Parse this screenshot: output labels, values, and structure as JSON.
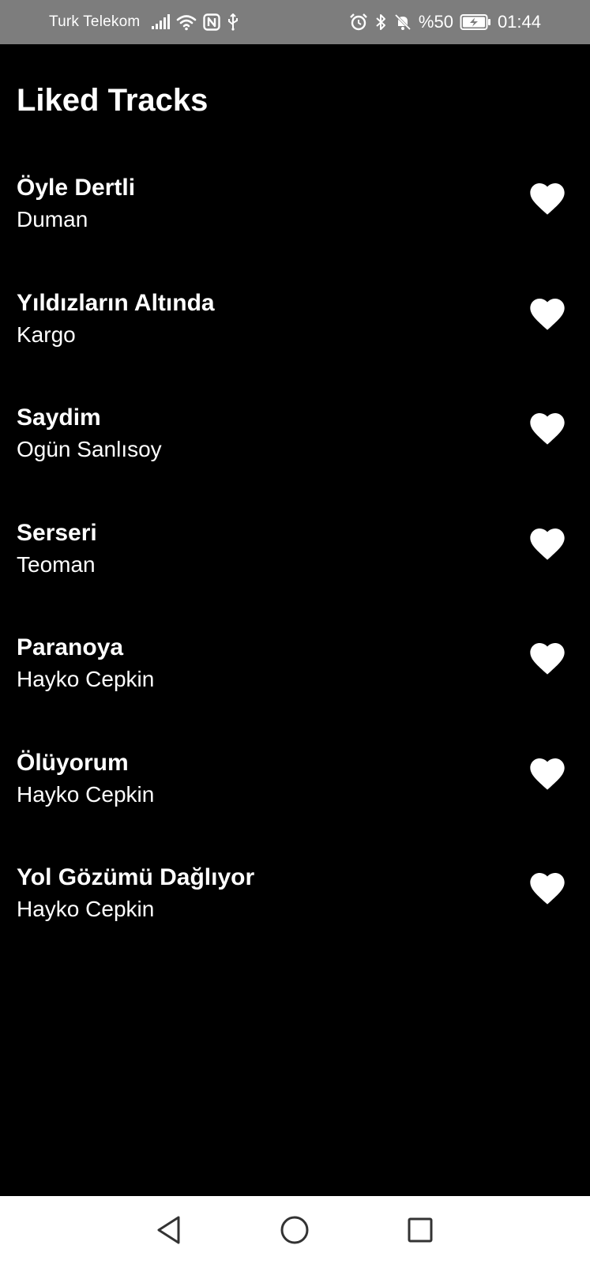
{
  "status_bar": {
    "carrier": "Turk Telekom",
    "battery_percent": "%50",
    "time": "01:44",
    "icons_left": [
      "signal-icon",
      "wifi-icon",
      "nfc-icon",
      "usb-icon"
    ],
    "icons_right": [
      "alarm-icon",
      "bluetooth-icon",
      "mute-icon",
      "battery-icon"
    ]
  },
  "page": {
    "title": "Liked Tracks"
  },
  "tracks": [
    {
      "title": "Öyle Dertli",
      "artist": "Duman",
      "liked": true
    },
    {
      "title": "Yıldızların Altında",
      "artist": "Kargo",
      "liked": true
    },
    {
      "title": "Saydim",
      "artist": "Ogün Sanlısoy",
      "liked": true
    },
    {
      "title": "Serseri",
      "artist": "Teoman",
      "liked": true
    },
    {
      "title": "Paranoya",
      "artist": "Hayko Cepkin",
      "liked": true
    },
    {
      "title": "Ölüyorum",
      "artist": "Hayko Cepkin",
      "liked": true
    },
    {
      "title": "Yol Gözümü Dağlıyor",
      "artist": "Hayko Cepkin",
      "liked": true
    }
  ],
  "nav_bar": {
    "icons": [
      "back-triangle-icon",
      "home-circle-icon",
      "recents-square-icon"
    ]
  },
  "colors": {
    "background": "#000000",
    "status_bar": "#7d7d7d",
    "text": "#ffffff",
    "nav_bar": "#ffffff",
    "nav_icon": "#333333"
  }
}
